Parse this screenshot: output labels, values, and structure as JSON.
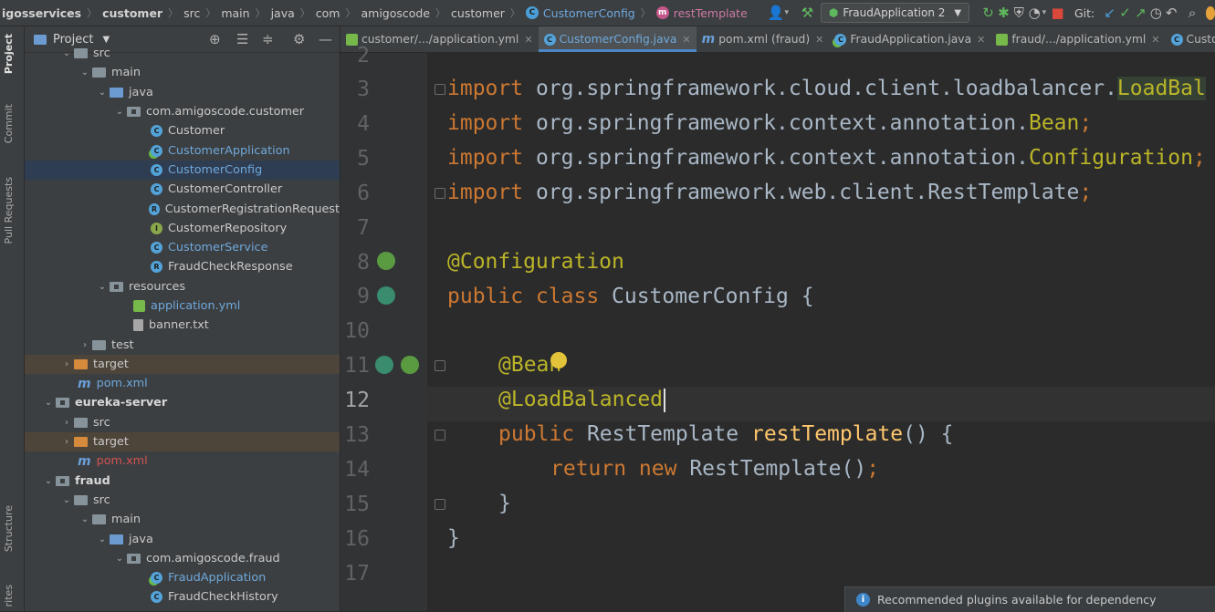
{
  "navbar": {
    "breadcrumbs": [
      "igosservices",
      "customer",
      "src",
      "main",
      "java",
      "com",
      "amigoscode",
      "customer"
    ],
    "class_crumb": "CustomerConfig",
    "method_crumb": "restTemplate",
    "run_config": "FraudApplication 2",
    "git_label": "Git:"
  },
  "left_strip": {
    "tabs": [
      "Project",
      "Commit",
      "Pull Requests",
      "Structure",
      "rites"
    ]
  },
  "project_panel": {
    "title": "Project",
    "tree": [
      {
        "label": "src",
        "icon": "folder-icon"
      },
      {
        "label": "main",
        "icon": "folder-icon"
      },
      {
        "label": "java",
        "icon": "folder-blue-icon"
      },
      {
        "label": "com.amigoscode.customer",
        "icon": "package-icon"
      },
      {
        "label": "Customer",
        "icon": "class-icon"
      },
      {
        "label": "CustomerApplication",
        "icon": "spring-class-icon"
      },
      {
        "label": "CustomerConfig",
        "icon": "class-icon"
      },
      {
        "label": "CustomerController",
        "icon": "class-icon"
      },
      {
        "label": "CustomerRegistrationRequest",
        "icon": "record-icon"
      },
      {
        "label": "CustomerRepository",
        "icon": "interface-icon"
      },
      {
        "label": "CustomerService",
        "icon": "class-icon"
      },
      {
        "label": "FraudCheckResponse",
        "icon": "record-icon"
      },
      {
        "label": "resources",
        "icon": "resources-folder-icon"
      },
      {
        "label": "application.yml",
        "icon": "yml-icon"
      },
      {
        "label": "banner.txt",
        "icon": "text-file-icon"
      },
      {
        "label": "test",
        "icon": "folder-icon"
      },
      {
        "label": "target",
        "icon": "folder-orange-icon"
      },
      {
        "label": "pom.xml",
        "icon": "maven-icon"
      },
      {
        "label": "eureka-server",
        "icon": "module-icon"
      },
      {
        "label": "src",
        "icon": "folder-icon"
      },
      {
        "label": "target",
        "icon": "folder-orange-icon"
      },
      {
        "label": "pom.xml",
        "icon": "maven-icon"
      },
      {
        "label": "fraud",
        "icon": "module-icon"
      },
      {
        "label": "src",
        "icon": "folder-icon"
      },
      {
        "label": "main",
        "icon": "folder-icon"
      },
      {
        "label": "java",
        "icon": "folder-blue-icon"
      },
      {
        "label": "com.amigoscode.fraud",
        "icon": "package-icon"
      },
      {
        "label": "FraudApplication",
        "icon": "spring-class-icon"
      },
      {
        "label": "FraudCheckHistory",
        "icon": "class-icon"
      }
    ]
  },
  "tabs": [
    {
      "label": "customer/.../application.yml",
      "icon": "yml-icon"
    },
    {
      "label": "CustomerConfig.java",
      "icon": "class-icon",
      "active": true
    },
    {
      "label": "pom.xml (fraud)",
      "icon": "maven-icon"
    },
    {
      "label": "FraudApplication.java",
      "icon": "spring-class-icon"
    },
    {
      "label": "fraud/.../application.yml",
      "icon": "yml-icon"
    },
    {
      "label": "CustomerService.java",
      "icon": "class-icon"
    }
  ],
  "editor": {
    "line_numbers": [
      "2",
      "3",
      "4",
      "5",
      "6",
      "7",
      "8",
      "9",
      "10",
      "11",
      "12",
      "13",
      "14",
      "15",
      "16",
      "17"
    ],
    "current_line": "12",
    "code": {
      "l3_kw": "import",
      "l3_pkg": " org.springframework.cloud.client.loadbalancer.",
      "l3_cls": "LoadBal",
      "l4_kw": "import",
      "l4_pkg": " org.springframework.context.annotation.",
      "l4_cls": "Bean",
      "l5_kw": "import",
      "l5_pkg": " org.springframework.context.annotation.",
      "l5_cls": "Configuration",
      "l6_kw": "import",
      "l6_pkg": " org.springframework.web.client.RestTemplate",
      "semi": ";",
      "l8_ann": "@Configuration",
      "l9_kw": "public class",
      "l9_rest": " CustomerConfig {",
      "l11_ann": "@Bean",
      "l12_ann": "@LoadBalanced",
      "l13_kw": "public",
      "l13_type": " RestTemplate ",
      "l13_meth": "restTemplate",
      "l13_rest": "() {",
      "l14_kw": "return new",
      "l14_rest": " RestTemplate()",
      "l15": "}",
      "l16": "}"
    }
  },
  "notification": {
    "text": "Recommended plugins available for dependency"
  }
}
